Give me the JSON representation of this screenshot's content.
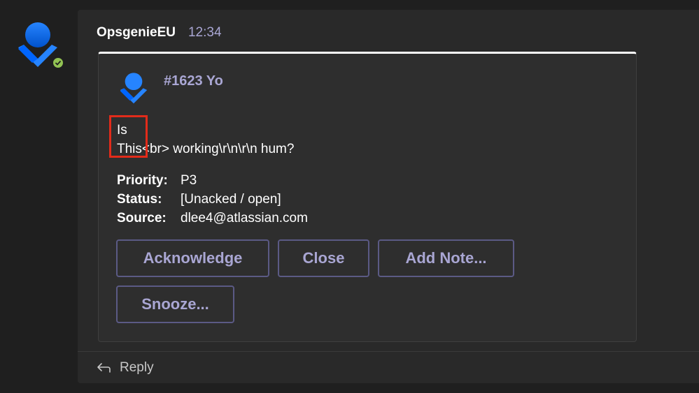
{
  "sender": {
    "name": "OpsgenieEU",
    "time": "12:34",
    "presence": "available"
  },
  "card": {
    "title": "#1623 Yo",
    "description": [
      "Is",
      "This<br> working\\r\\n\\r\\n hum?"
    ],
    "facts": [
      {
        "label": "Priority:",
        "value": "P3"
      },
      {
        "label": "Status:",
        "value": "[Unacked / open]"
      },
      {
        "label": "Source:",
        "value": "dlee4@atlassian.com"
      }
    ],
    "actions": {
      "acknowledge": "Acknowledge",
      "close": "Close",
      "add_note": "Add Note...",
      "snooze": "Snooze..."
    }
  },
  "reply": {
    "label": "Reply"
  },
  "colors": {
    "accent": "#a9a6d3",
    "highlight": "#e22b1a",
    "presence": "#92c353",
    "brand": "#2684ff"
  }
}
